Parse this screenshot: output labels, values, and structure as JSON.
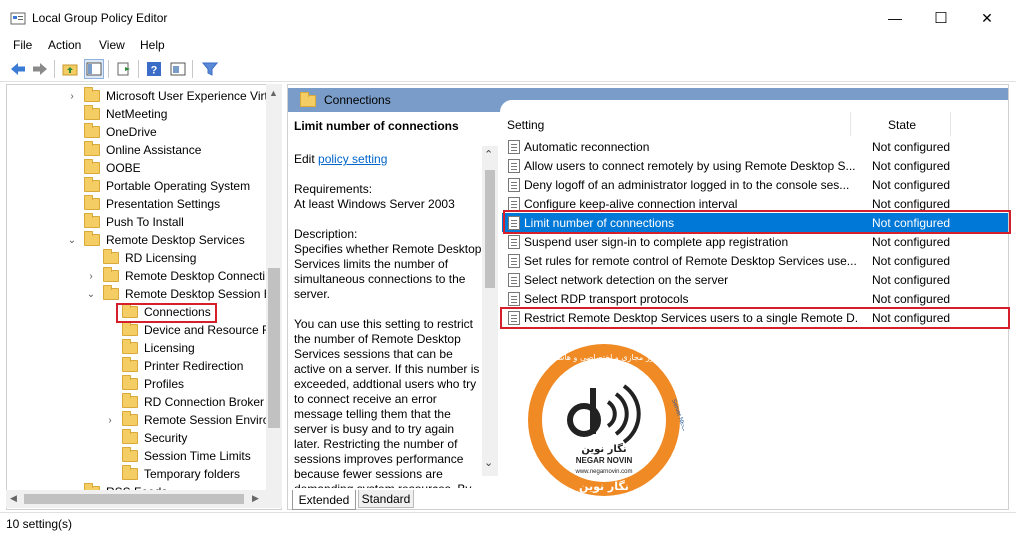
{
  "window": {
    "title": "Local Group Policy Editor",
    "minimize": "—",
    "maximize": "☐",
    "close": "✕"
  },
  "menu": [
    "File",
    "Action",
    "View",
    "Help"
  ],
  "tree": [
    {
      "label": "Microsoft User Experience Virt",
      "arrow": "›"
    },
    {
      "label": "NetMeeting",
      "arrow": ""
    },
    {
      "label": "OneDrive",
      "arrow": ""
    },
    {
      "label": "Online Assistance",
      "arrow": ""
    },
    {
      "label": "OOBE",
      "arrow": ""
    },
    {
      "label": "Portable Operating System",
      "arrow": ""
    },
    {
      "label": "Presentation Settings",
      "arrow": ""
    },
    {
      "label": "Push To Install",
      "arrow": ""
    },
    {
      "label": "Remote Desktop Services",
      "arrow": "⌄"
    },
    {
      "label": "RD Licensing",
      "arrow": ""
    },
    {
      "label": "Remote Desktop Connecti",
      "arrow": "›"
    },
    {
      "label": "Remote Desktop Session H",
      "arrow": "⌄"
    },
    {
      "label": "Connections",
      "arrow": ""
    },
    {
      "label": "Device and Resource Re",
      "arrow": ""
    },
    {
      "label": "Licensing",
      "arrow": ""
    },
    {
      "label": "Printer Redirection",
      "arrow": ""
    },
    {
      "label": "Profiles",
      "arrow": ""
    },
    {
      "label": "RD Connection Broker",
      "arrow": ""
    },
    {
      "label": "Remote Session Enviro",
      "arrow": "›"
    },
    {
      "label": "Security",
      "arrow": ""
    },
    {
      "label": "Session Time Limits",
      "arrow": ""
    },
    {
      "label": "Temporary folders",
      "arrow": ""
    },
    {
      "label": "RSS Feeds",
      "arrow": ""
    }
  ],
  "right_header": "Connections",
  "description": {
    "title": "Limit number of connections",
    "edit_prefix": "Edit",
    "edit_link": "policy setting",
    "requirements_label": "Requirements:",
    "requirements_value": "At least Windows Server 2003",
    "description_label": "Description:",
    "paragraph1": "Specifies whether Remote Desktop Services limits the number of simultaneous connections to the server.",
    "paragraph2": "You can use this setting to restrict the number of Remote Desktop Services sessions that can be active on a server. If this number is exceeded, addtional users who try to connect receive an error message telling them that the server is busy and to try again later. Restricting the number of sessions improves performance because fewer sessions are demanding system resources. By"
  },
  "columns": {
    "setting": "Setting",
    "state": "State"
  },
  "settings": [
    {
      "name": "Automatic reconnection",
      "state": "Not configured"
    },
    {
      "name": "Allow users to connect remotely by using Remote Desktop S...",
      "state": "Not configured"
    },
    {
      "name": "Deny logoff of an administrator logged in to the console ses...",
      "state": "Not configured"
    },
    {
      "name": "Configure keep-alive connection interval",
      "state": "Not configured"
    },
    {
      "name": "Limit number of connections",
      "state": "Not configured"
    },
    {
      "name": "Suspend user sign-in to complete app registration",
      "state": "Not configured"
    },
    {
      "name": "Set rules for remote control of Remote Desktop Services use...",
      "state": "Not configured"
    },
    {
      "name": "Select network detection on the server",
      "state": "Not configured"
    },
    {
      "name": "Select RDP transport protocols",
      "state": "Not configured"
    },
    {
      "name": "Restrict Remote Desktop Services users to a single Remote D...",
      "state": "Not configured"
    }
  ],
  "tabs": {
    "extended": "Extended",
    "standard": "Standard"
  },
  "status": "10 setting(s)",
  "watermark": {
    "name_fa": "نگار نوین",
    "name_en": "NEGAR NOVIN",
    "url": "www.negarnovin.com",
    "arc_text": "سرور مجازی و اختصاصی و هاستینگ",
    "side_text": "Server NEGAR NOVIN"
  },
  "colors": {
    "selection": "#0078d7",
    "highlight_box": "#d4202a",
    "header_bar": "#7a9cc8",
    "watermark_orange": "#f08a24"
  }
}
